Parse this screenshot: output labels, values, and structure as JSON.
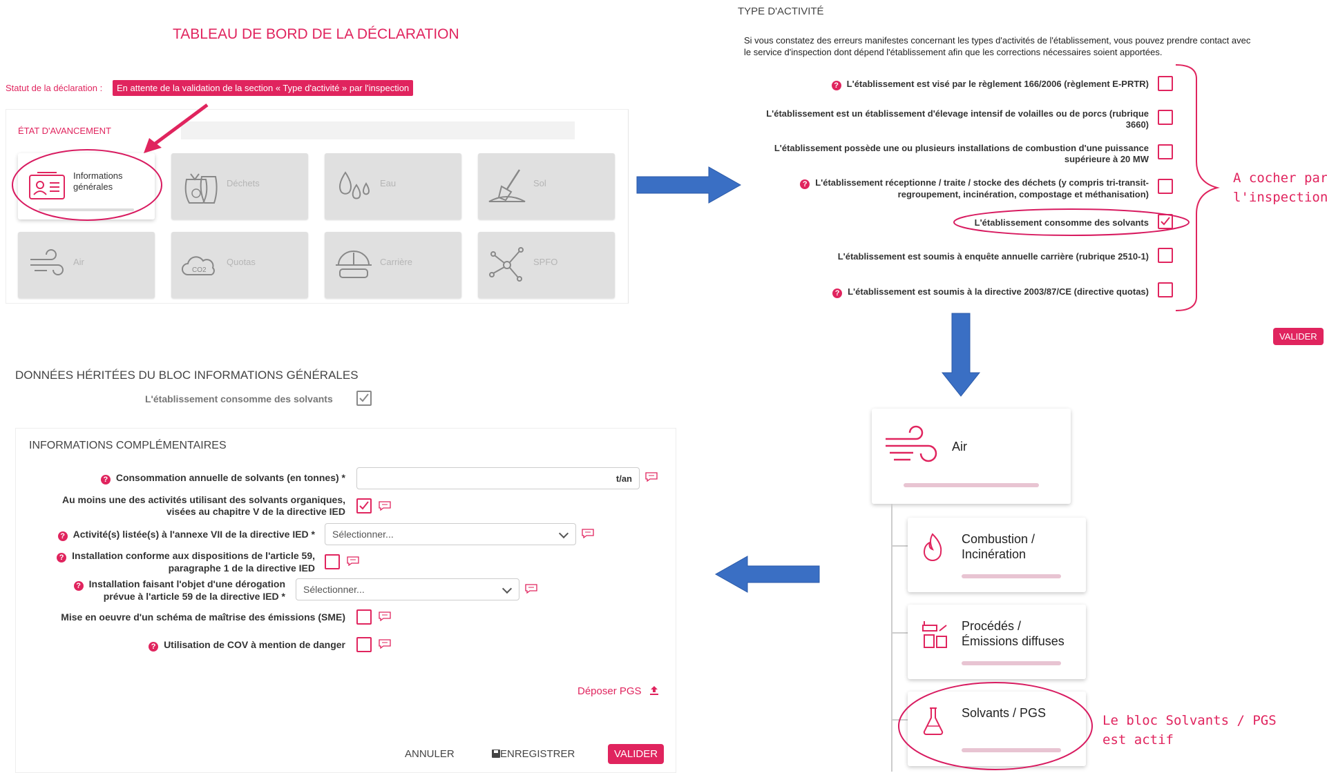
{
  "dashboard": {
    "title": "TABLEAU DE BORD DE LA DÉCLARATION",
    "statut_label": "Statut de la déclaration :",
    "statut_value": "En attente de la validation de la section « Type d'activité » par l'inspection",
    "etat_label": "ÉTAT D'AVANCEMENT",
    "tiles": [
      {
        "label": "Informations générales",
        "icon": "id-card-icon",
        "state": "active"
      },
      {
        "label": "Déchets",
        "icon": "waste-bags-icon",
        "state": "disabled"
      },
      {
        "label": "Eau",
        "icon": "water-drops-icon",
        "state": "disabled"
      },
      {
        "label": "Sol",
        "icon": "shovel-icon",
        "state": "disabled"
      },
      {
        "label": "Air",
        "icon": "wind-icon",
        "state": "disabled"
      },
      {
        "label": "Quotas",
        "icon": "co2-cloud-icon",
        "state": "disabled"
      },
      {
        "label": "Carrière",
        "icon": "helmet-icon",
        "state": "disabled"
      },
      {
        "label": "SPFO",
        "icon": "molecule-icon",
        "state": "disabled"
      }
    ]
  },
  "type_activite": {
    "title": "TYPE D'ACTIVITÉ",
    "intro_line1": "Si vous constatez des erreurs manifestes concernant les types d'activités de l'établissement, vous pouvez prendre contact avec",
    "intro_line2": "le service d'inspection dont dépend l'établissement afin que les corrections nécessaires soient apportées.",
    "items": [
      {
        "line1": "L'établissement est visé par le règlement 166/2006 (règlement E-PRTR)",
        "line2": "",
        "help": true,
        "checked": false
      },
      {
        "line1": "L'établissement est un établissement d'élevage intensif de volailles ou de porcs (rubrique",
        "line2": "3660)",
        "help": false,
        "checked": false
      },
      {
        "line1": "L'établissement possède une ou plusieurs installations de combustion d'une puissance",
        "line2": "supérieure à 20 MW",
        "help": false,
        "checked": false
      },
      {
        "line1": "L'établissement réceptionne / traite / stocke des déchets (y compris tri-transit-",
        "line2": "regroupement, incinération, compostage et méthanisation)",
        "help": true,
        "checked": false
      },
      {
        "line1": "L'établissement consomme des solvants",
        "line2": "",
        "help": false,
        "checked": true
      },
      {
        "line1": "L'établissement est soumis à enquête annuelle carrière (rubrique 2510-1)",
        "line2": "",
        "help": false,
        "checked": false
      },
      {
        "line1": "L'établissement est soumis à la directive 2003/87/CE (directive quotas)",
        "line2": "",
        "help": true,
        "checked": false
      }
    ],
    "valider": "VALIDER",
    "annotation_line1": "A cocher par",
    "annotation_line2": "l'inspection"
  },
  "form": {
    "inherited_title": "DONNÉES HÉRITÉES DU BLOC INFORMATIONS GÉNÉRALES",
    "inherited_item": "L'établissement consomme des solvants",
    "complement_title": "INFORMATIONS COMPLÉMENTAIRES",
    "f1_label": "Consommation annuelle de solvants (en tonnes) *",
    "f1_unit": "t/an",
    "f2_label_1": "Au moins une des activités utilisant des solvants organiques,",
    "f2_label_2": "visées au chapitre V de la directive IED",
    "f3_label": "Activité(s) listée(s) à l'annexe VII de la directive IED *",
    "f3_placeholder": "Sélectionner...",
    "f4_label_1": "Installation conforme aux dispositions de l'article 59,",
    "f4_label_2": "paragraphe 1 de la directive IED",
    "f5_label_1": "Installation faisant l'objet d'une dérogation",
    "f5_label_2": "prévue à l'article 59 de la directive IED *",
    "f5_placeholder": "Sélectionner...",
    "f6_label": "Mise en oeuvre d'un schéma de maîtrise des émissions (SME)",
    "f7_label": "Utilisation de COV à mention de danger",
    "deposer": "Déposer PGS",
    "annuler": "ANNULER",
    "enregistrer": "ENREGISTRER",
    "valider": "VALIDER"
  },
  "air_tree": {
    "root": "Air",
    "children": [
      {
        "label_1": "Combustion /",
        "label_2": "Incinération",
        "icon": "flame-icon"
      },
      {
        "label_1": "Procédés /",
        "label_2": "Émissions diffuses",
        "icon": "process-icon"
      },
      {
        "label_1": "Solvants / PGS",
        "label_2": "",
        "icon": "flask-icon"
      }
    ],
    "annotation_line1": "Le bloc Solvants / PGS",
    "annotation_line2": "est actif"
  },
  "colors": {
    "accent": "#e0245e",
    "arrow_blue": "#3a6fc4"
  }
}
